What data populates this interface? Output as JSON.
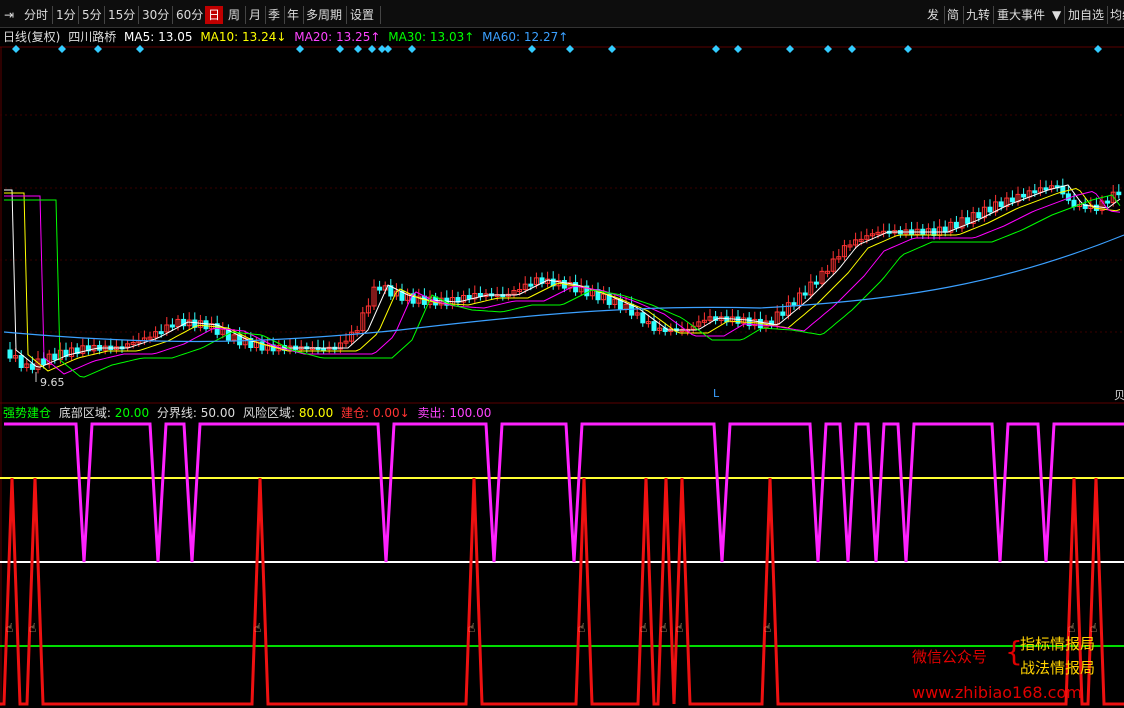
{
  "toolbar": {
    "pin_icon": "pin-icon",
    "periods": [
      "分时",
      "1分",
      "5分",
      "15分",
      "30分",
      "60分",
      "日",
      "周",
      "月",
      "季",
      "年",
      "多周期",
      "设置"
    ],
    "active_period": "日",
    "right_items": [
      "发",
      "简",
      "九转",
      "重大事件",
      "加自选",
      "均线"
    ]
  },
  "info_line": {
    "period": "日线(复权)",
    "name": "四川路桥",
    "ma5_label": "MA5:",
    "ma5_value": "13.05",
    "ma10_label": "MA10:",
    "ma10_value": "13.24↓",
    "ma20_label": "MA20:",
    "ma20_value": "13.25↑",
    "ma30_label": "MA30:",
    "ma30_value": "13.03↑",
    "ma60_label": "MA60:",
    "ma60_value": "12.27↑"
  },
  "price_chart": {
    "low_label": "9.65",
    "marker_L": "L",
    "right_edge_label": "贝",
    "colors": {
      "up": "#ff3333",
      "down": "#33ffff",
      "ma5": "#ffffff",
      "ma10": "#ffff00",
      "ma20": "#ff00ff",
      "ma30": "#00ff00",
      "ma60": "#3ba0ff"
    }
  },
  "indicator_line": {
    "name": "强势建仓",
    "bottom_label": "底部区域:",
    "bottom_value": "20.00",
    "divider_label": "分界线:",
    "divider_value": "50.00",
    "risk_label": "风险区域:",
    "risk_value": "80.00",
    "build_label": "建仓:",
    "build_value": "0.00↓",
    "sell_label": "卖出:",
    "sell_value": "100.00"
  },
  "watermark": {
    "wechat": "微信公众号",
    "line1": "指标情报局",
    "line2": "战法情报局",
    "url": "www.zhibiao168.com"
  }
}
